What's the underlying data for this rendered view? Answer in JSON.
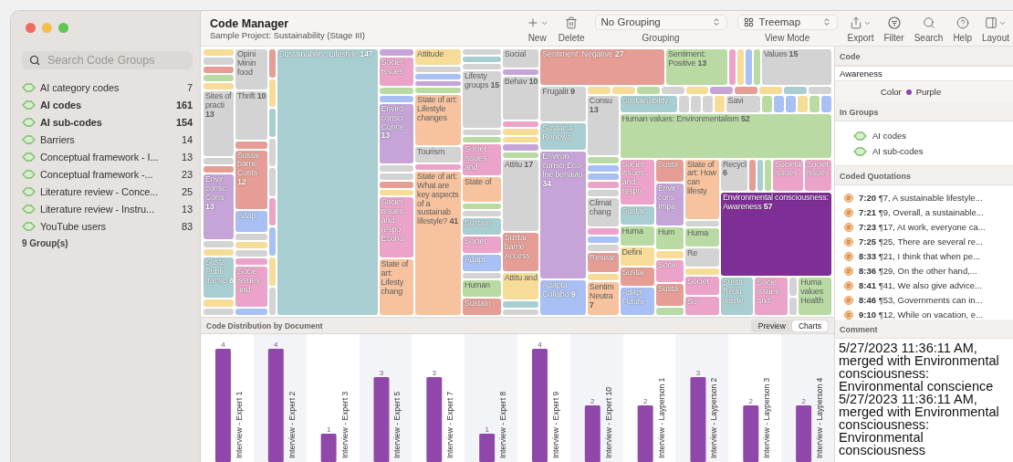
{
  "window": {
    "title": "Code Manager",
    "subtitle": "Sample Project: Sustainability (Stage III)"
  },
  "sidebar": {
    "search": {
      "placeholder": "Search Code Groups"
    },
    "items": [
      {
        "label": "AI category codes",
        "count": "7",
        "selected": false
      },
      {
        "label": "AI codes",
        "count": "161",
        "selected": true
      },
      {
        "label": "AI sub-codes",
        "count": "154",
        "selected": true
      },
      {
        "label": "Barriers",
        "count": "14",
        "selected": false
      },
      {
        "label": "Conceptual framework - I...",
        "count": "13",
        "selected": false
      },
      {
        "label": "Conceptual framework -...",
        "count": "23",
        "selected": false
      },
      {
        "label": "Literature review - Conce...",
        "count": "25",
        "selected": false
      },
      {
        "label": "Literature review - Instru...",
        "count": "13",
        "selected": false
      },
      {
        "label": "YouTube users",
        "count": "83",
        "selected": false
      }
    ],
    "footer": "9 Group(s)"
  },
  "toolbar": [
    {
      "kind": "new",
      "label": "New"
    },
    {
      "kind": "delete",
      "label": "Delete"
    },
    {
      "kind": "grouping",
      "value": "No Grouping",
      "label": "Grouping"
    },
    {
      "kind": "viewmode",
      "value": "Treemap",
      "label": "View Mode"
    },
    {
      "kind": "export",
      "label": "Export"
    },
    {
      "kind": "filter",
      "label": "Filter"
    },
    {
      "kind": "search",
      "label": "Search"
    },
    {
      "kind": "help",
      "label": "Help"
    },
    {
      "kind": "layout",
      "label": "Layout"
    }
  ],
  "treemap": {
    "kind": "row",
    "children": [
      {
        "kind": "col",
        "children": [
          {
            "kind": "tile",
            "color": "#f6dc97"
          },
          {
            "kind": "tile",
            "color": "#d3d3d3"
          },
          {
            "kind": "tile",
            "color": "#e59d95"
          },
          {
            "kind": "tile",
            "color": "#b9dba3"
          },
          {
            "kind": "tile",
            "color": "#f6dc97"
          },
          {
            "kind": "tile",
            "label": "Sites of practi",
            "count": "13",
            "color": "#d3d3d3"
          },
          {
            "kind": "tile",
            "color": "#d3d3d3"
          },
          {
            "kind": "tile",
            "color": "#e59d95"
          },
          {
            "kind": "tile",
            "label": "Envir consc Cons",
            "count": "13",
            "color": "#c6a4d8"
          },
          {
            "kind": "tile",
            "color": "#d3d3d3"
          },
          {
            "kind": "tile",
            "color": "#f6dc97"
          },
          {
            "kind": "tile",
            "label": "Susta Publi transp",
            "count": "8",
            "color": "#a8ced2"
          },
          {
            "kind": "tile",
            "color": "#f6dc97"
          },
          {
            "kind": "tile",
            "color": "#d3d3d3"
          }
        ]
      },
      {
        "kind": "col",
        "children": [
          {
            "kind": "tile",
            "label": "Opini Minin food",
            "color": "#d3d3d3"
          },
          {
            "kind": "tile",
            "label": "Thrift",
            "count": "10",
            "color": "#d3d3d3"
          },
          {
            "kind": "tile",
            "color": "#e59d95"
          },
          {
            "kind": "tile",
            "label": "Sustai barrie Costs",
            "count": "12",
            "color": "#e59d95"
          },
          {
            "kind": "tile",
            "label": "Adap",
            "color": "#a8c0f3"
          },
          {
            "kind": "tile",
            "color": "#d3d3d3"
          },
          {
            "kind": "tile",
            "color": "#f6dc97"
          },
          {
            "kind": "tile",
            "color": "#d3d3d3"
          },
          {
            "kind": "tile",
            "color": "#eba3c9"
          },
          {
            "kind": "tile",
            "label": "Socie issues and",
            "color": "#eba3c9"
          },
          {
            "kind": "tile",
            "color": "#a8c0f3"
          }
        ]
      },
      {
        "kind": "col",
        "children": [
          {
            "kind": "tile",
            "color": "#e59d95"
          },
          {
            "kind": "tile",
            "color": "#f6dc97"
          },
          {
            "kind": "tile",
            "color": "#a8ced2"
          },
          {
            "kind": "tile",
            "color": "#d3d3d3"
          },
          {
            "kind": "tile",
            "color": "#d3d3d3"
          },
          {
            "kind": "tile",
            "color": "#eba3c9"
          },
          {
            "kind": "tile",
            "color": "#a8c0f3"
          },
          {
            "kind": "tile",
            "color": "#f6dc97"
          },
          {
            "kind": "tile",
            "color": "#d3d3d3"
          }
        ]
      },
      {
        "kind": "tile",
        "label": "Sustainability: Lifestyle",
        "count": "147",
        "color": "#a8ced2"
      },
      {
        "kind": "col",
        "children": [
          {
            "kind": "tile",
            "color": "#c6a4d8"
          },
          {
            "kind": "tile",
            "label": "Societ issues",
            "color": "#eba3c9"
          },
          {
            "kind": "tile",
            "color": "#b9dba3"
          },
          {
            "kind": "tile",
            "color": "#a8c0f3"
          },
          {
            "kind": "tile",
            "label": "Enviro consci Conce",
            "count": "13",
            "color": "#c6a4d8"
          },
          {
            "kind": "tile",
            "color": "#d3d3d3"
          },
          {
            "kind": "tile",
            "color": "#d3d3d3"
          },
          {
            "kind": "tile",
            "color": "#e59d95"
          },
          {
            "kind": "tile",
            "color": "#f6dc97"
          },
          {
            "kind": "tile",
            "label": "Societ issues and respo Econo",
            "color": "#eba3c9"
          },
          {
            "kind": "tile",
            "label": "State of art: Lifesty chang",
            "color": "#f7c39f"
          }
        ]
      },
      {
        "kind": "col",
        "children": [
          {
            "kind": "tile",
            "label": "Attitude",
            "color": "#f6dc97"
          },
          {
            "kind": "tile",
            "color": "#d3d3d3"
          },
          {
            "kind": "tile",
            "color": "#a8c0f3"
          },
          {
            "kind": "tile",
            "color": "#c6a4d8"
          },
          {
            "kind": "tile",
            "color": "#b9dba3"
          },
          {
            "kind": "tile",
            "label": "State of art: Lifestyle changes",
            "color": "#f7c39f"
          },
          {
            "kind": "tile",
            "label": "Tourism",
            "color": "#d3d3d3"
          },
          {
            "kind": "tile",
            "color": "#eba3c9"
          },
          {
            "kind": "tile",
            "label": "State of art: What are key aspects of a sustainab lifestyle?",
            "count": "41",
            "color": "#f7c39f"
          }
        ]
      },
      {
        "kind": "col",
        "children": [
          {
            "kind": "tile",
            "color": "#d3d3d3"
          },
          {
            "kind": "tile",
            "color": "#a8ced2"
          },
          {
            "kind": "tile",
            "color": "#d3d3d3"
          },
          {
            "kind": "tile",
            "label": "Lifesty groups",
            "count": "15",
            "color": "#d3d3d3"
          },
          {
            "kind": "tile",
            "color": "#d3d3d3"
          },
          {
            "kind": "tile",
            "color": "#b9dba3"
          },
          {
            "kind": "tile",
            "label": "Societ issues and",
            "color": "#eba3c9"
          },
          {
            "kind": "tile",
            "label": "State of",
            "color": "#f7c39f"
          },
          {
            "kind": "tile",
            "color": "#b9dba3"
          },
          {
            "kind": "tile",
            "color": "#d3d3d3"
          },
          {
            "kind": "tile",
            "label": "Sustain",
            "color": "#a8ced2"
          },
          {
            "kind": "tile",
            "label": "Societ",
            "color": "#eba3c9"
          },
          {
            "kind": "tile",
            "label": "Adapt",
            "color": "#a8c0f3"
          },
          {
            "kind": "tile",
            "color": "#d3d3d3"
          },
          {
            "kind": "tile",
            "label": "Human",
            "color": "#b9dba3"
          },
          {
            "kind": "tile",
            "label": "Sustain",
            "color": "#e59d95"
          }
        ]
      },
      {
        "kind": "col",
        "children": [
          {
            "kind": "tile",
            "label": "Social",
            "color": "#d3d3d3"
          },
          {
            "kind": "tile",
            "color": "#c6a4d8"
          },
          {
            "kind": "tile",
            "label": "Behav",
            "count": "10",
            "color": "#d3d3d3"
          },
          {
            "kind": "tile",
            "color": "#eba3c9"
          },
          {
            "kind": "tile",
            "color": "#f6dc97"
          },
          {
            "kind": "tile",
            "color": "#f6dc97"
          },
          {
            "kind": "tile",
            "color": "#c6a4d8"
          },
          {
            "kind": "tile",
            "color": "#b9dba3"
          },
          {
            "kind": "tile",
            "label": "Attitu",
            "count": "17",
            "color": "#d3d3d3"
          },
          {
            "kind": "tile",
            "label": "Sustai barrie Access",
            "color": "#e59d95"
          },
          {
            "kind": "tile",
            "label": "Attitu and",
            "color": "#f6dc97"
          },
          {
            "kind": "tile",
            "color": "#a8ced2"
          },
          {
            "kind": "tile",
            "color": "#d3d3d3"
          }
        ]
      },
      {
        "kind": "col",
        "children": [
          {
            "kind": "row",
            "children": [
              {
                "kind": "tile",
                "label": "Sentiment: Negative",
                "count": "27",
                "color": "#e59d95"
              },
              {
                "kind": "tile",
                "label": "Sentiment: Positive",
                "count": "13",
                "color": "#b9dba3"
              },
              {
                "kind": "tile",
                "color": "#eba3c9"
              },
              {
                "kind": "tile",
                "color": "#f6dc97"
              },
              {
                "kind": "tile",
                "color": "#a8c0f3"
              },
              {
                "kind": "tile",
                "color": "#b9dba3"
              },
              {
                "kind": "tile",
                "label": "Values",
                "count": "15",
                "color": "#d3d3d3"
              }
            ]
          },
          {
            "kind": "row",
            "children": [
              {
                "kind": "col",
                "children": [
                  {
                    "kind": "tile",
                    "label": "Frugalit",
                    "count": "9",
                    "color": "#d3d3d3"
                  },
                  {
                    "kind": "tile",
                    "label": "Sustaina Renewa",
                    "color": "#a8ced2"
                  },
                  {
                    "kind": "tile",
                    "label": "Environ consci Eco-frie behavio",
                    "count": "34",
                    "color": "#c6a4d8"
                  },
                  {
                    "kind": "tile",
                    "label": "Adapta Collabo",
                    "count": "9",
                    "color": "#a8c0f3"
                  }
                ]
              },
              {
                "kind": "col",
                "children": [
                  {
                    "kind": "row",
                    "children": [
                      {
                        "kind": "tile",
                        "color": "#f6dc97"
                      },
                      {
                        "kind": "tile",
                        "color": "#f6dc97"
                      },
                      {
                        "kind": "tile",
                        "color": "#b9dba3"
                      },
                      {
                        "kind": "tile",
                        "color": "#d3d3d3"
                      },
                      {
                        "kind": "tile",
                        "color": "#f6dc97"
                      },
                      {
                        "kind": "tile",
                        "color": "#c6a4d8"
                      },
                      {
                        "kind": "tile",
                        "color": "#e59d95"
                      },
                      {
                        "kind": "tile",
                        "color": "#f6dc97"
                      },
                      {
                        "kind": "tile",
                        "color": "#a8ced2"
                      },
                      {
                        "kind": "tile",
                        "color": "#d3d3d3"
                      }
                    ]
                  },
                  {
                    "kind": "row",
                    "children": [
                      {
                        "kind": "col",
                        "children": [
                          {
                            "kind": "tile",
                            "label": "Consu",
                            "count": "13",
                            "color": "#d3d3d3"
                          },
                          {
                            "kind": "tile",
                            "color": "#b9dba3"
                          },
                          {
                            "kind": "tile",
                            "color": "#a8c0f3"
                          },
                          {
                            "kind": "tile",
                            "color": "#a8c0f3"
                          },
                          {
                            "kind": "tile",
                            "color": "#eba3c9"
                          },
                          {
                            "kind": "tile",
                            "color": "#d3d3d3"
                          },
                          {
                            "kind": "tile",
                            "label": "Climat chang",
                            "color": "#d3d3d3"
                          },
                          {
                            "kind": "tile",
                            "color": "#eba3c9"
                          },
                          {
                            "kind": "tile",
                            "color": "#a8c0f3"
                          },
                          {
                            "kind": "tile",
                            "color": "#d3d3d3"
                          },
                          {
                            "kind": "tile",
                            "label": "Resear",
                            "color": "#e59d95"
                          },
                          {
                            "kind": "tile",
                            "color": "#f6dc97"
                          },
                          {
                            "kind": "tile",
                            "label": "Sentim Neutra",
                            "count": "7",
                            "color": "#f7c39f"
                          }
                        ]
                      },
                      {
                        "kind": "col",
                        "children": [
                          {
                            "kind": "row",
                            "children": [
                              {
                                "kind": "tile",
                                "label": "Sustainability:",
                                "color": "#a8ced2"
                              },
                              {
                                "kind": "tile",
                                "color": "#d3d3d3"
                              },
                              {
                                "kind": "tile",
                                "color": "#d3d3d3"
                              },
                              {
                                "kind": "tile",
                                "color": "#d3d3d3"
                              },
                              {
                                "kind": "tile",
                                "color": "#f6dc97"
                              },
                              {
                                "kind": "tile",
                                "label": "Savi",
                                "color": "#d3d3d3"
                              },
                              {
                                "kind": "tile",
                                "color": "#b9dba3"
                              },
                              {
                                "kind": "tile",
                                "color": "#a8c0f3"
                              },
                              {
                                "kind": "tile",
                                "color": "#a8c0f3"
                              },
                              {
                                "kind": "tile",
                                "color": "#f6dc97"
                              },
                              {
                                "kind": "tile",
                                "color": "#b9dba3"
                              },
                              {
                                "kind": "tile",
                                "color": "#a8c0f3"
                              }
                            ]
                          },
                          {
                            "kind": "tile",
                            "label": "Human values: Environmentalism",
                            "count": "52",
                            "color": "#b9dba3"
                          },
                          {
                            "kind": "row",
                            "children": [
                              {
                                "kind": "col",
                                "children": [
                                  {
                                    "kind": "tile",
                                    "label": "Societ issues and respo",
                                    "color": "#eba3c9"
                                  },
                                  {
                                    "kind": "tile",
                                    "label": "Sustai",
                                    "color": "#a8ced2"
                                  },
                                  {
                                    "kind": "tile",
                                    "label": "Huma",
                                    "color": "#b9dba3"
                                  },
                                  {
                                    "kind": "tile",
                                    "label": "Defini",
                                    "color": "#f6dc97"
                                  },
                                  {
                                    "kind": "tile",
                                    "label": "Sustai",
                                    "color": "#e59d95"
                                  },
                                  {
                                    "kind": "tile",
                                    "label": "Adapt Future",
                                    "color": "#a8c0f3"
                                  }
                                ]
                              },
                              {
                                "kind": "col",
                                "children": [
                                  {
                                    "kind": "tile",
                                    "label": "Susta",
                                    "color": "#e59d95"
                                  },
                                  {
                                    "kind": "tile",
                                    "label": "Envir cons Impa",
                                    "color": "#c6a4d8"
                                  },
                                  {
                                    "kind": "tile",
                                    "label": "Hum",
                                    "color": "#b9dba3"
                                  },
                                  {
                                    "kind": "tile",
                                    "color": "#f6dc97"
                                  },
                                  {
                                    "kind": "tile",
                                    "label": "Socie",
                                    "color": "#eba3c9"
                                  },
                                  {
                                    "kind": "tile",
                                    "label": "Susta",
                                    "color": "#e59d95"
                                  },
                                  {
                                    "kind": "tile",
                                    "color": "#b9dba3"
                                  }
                                ]
                              },
                              {
                                "kind": "col",
                                "children": [
                                  {
                                    "kind": "tile",
                                    "label": "State of art: How can lifesty",
                                    "color": "#f7c39f"
                                  },
                                  {
                                    "kind": "tile",
                                    "color": "#d3d3d3"
                                  },
                                  {
                                    "kind": "tile",
                                    "label": "Huma",
                                    "color": "#b9dba3"
                                  },
                                  {
                                    "kind": "tile",
                                    "label": "Re",
                                    "color": "#d3d3d3"
                                  },
                                  {
                                    "kind": "tile",
                                    "color": "#f6dc97"
                                  },
                                  {
                                    "kind": "tile",
                                    "label": "Societ",
                                    "color": "#eba3c9"
                                  },
                                  {
                                    "kind": "tile",
                                    "label": "So",
                                    "color": "#eba3c9"
                                  }
                                ]
                              },
                              {
                                "kind": "col",
                                "children": [
                                  {
                                    "kind": "row",
                                    "children": [
                                      {
                                        "kind": "tile",
                                        "label": "Recycl",
                                        "count": "6",
                                        "color": "#d3d3d3"
                                      },
                                      {
                                        "kind": "tile",
                                        "color": "#e59d95"
                                      },
                                      {
                                        "kind": "tile",
                                        "color": "#a8ced2"
                                      },
                                      {
                                        "kind": "tile",
                                        "color": "#b9dba3"
                                      },
                                      {
                                        "kind": "tile",
                                        "label": "Societal issues",
                                        "color": "#eba3c9"
                                      },
                                      {
                                        "kind": "tile",
                                        "label": "Societ issues",
                                        "color": "#eba3c9"
                                      }
                                    ]
                                  },
                                  {
                                    "kind": "tile",
                                    "label": "Environmental consciousness: Awareness",
                                    "count": "57",
                                    "color": "#7e2f96"
                                  },
                                  {
                                    "kind": "row",
                                    "children": [
                                      {
                                        "kind": "tile",
                                        "label": "Susta Redu waste",
                                        "color": "#a8ced2"
                                      },
                                      {
                                        "kind": "tile",
                                        "label": "Socie issues and",
                                        "color": "#eba3c9"
                                      },
                                      {
                                        "kind": "col",
                                        "children": [
                                          {
                                            "kind": "tile",
                                            "color": "#d3d3d3"
                                          },
                                          {
                                            "kind": "tile",
                                            "color": "#d3d3d3"
                                          }
                                        ]
                                      },
                                      {
                                        "kind": "tile",
                                        "label": "Huma values Health",
                                        "color": "#b9dba3"
                                      }
                                    ]
                                  }
                                ]
                              }
                            ]
                          }
                        ]
                      }
                    ]
                  }
                ]
              }
            ]
          }
        ]
      }
    ]
  },
  "distribution": {
    "title": "Code Distribution by Document",
    "tabs": [
      {
        "label": "Preview",
        "selected": false
      },
      {
        "label": "Charts",
        "selected": true
      }
    ],
    "chart_data": {
      "type": "bar",
      "categories": [
        "Interview - Expert 1",
        "Interview - Expert 2",
        "Interview - Expert 3",
        "Interview - Expert 5",
        "Interview - Expert 7",
        "Interview - Expert 8",
        "Interview - Expert 9",
        "Interview - Expert 10",
        "Interview - Layperson 1",
        "Interview - Layperson 2",
        "Interview - Layperson 3",
        "Interview - Layperson 4"
      ],
      "series": [
        {
          "color": "#8f48aa",
          "values": [
            4,
            4,
            1,
            3,
            3,
            1,
            4,
            2,
            2,
            3,
            2,
            2
          ]
        }
      ],
      "data_labels": true
    }
  },
  "inspector": {
    "code_header": "Code",
    "code_value": "Awareness",
    "color_label": "Color",
    "color_name": "Purple",
    "color": "#8e44ad",
    "groups_header": "In Groups",
    "groups": [
      "AI codes",
      "AI sub-codes"
    ],
    "quotations_header": "Coded Quotations",
    "quotations": [
      "**7:20** ¶7, A sustainable lifestyle...",
      "**7:21** ¶9, Overall, a sustainable...",
      "**7:23** ¶17, At work, everyone ca...",
      "**7:25** ¶25, There are several re...",
      "**8:33** ¶21, I think that when pe...",
      "**8:36** ¶29, On the other hand,...",
      "**8:41** ¶41, We also give advice...",
      "**8:46** ¶53, Governments can in...",
      "**9:10** ¶12, While on vacation, e..."
    ],
    "comment_header": "Comment",
    "comment": [
      "5/27/2023 11:36:11 AM, merged with Environmental consciousness: Environmental conscience",
      "5/27/2023 11:36:11 AM, merged with Environmental consciousness: Environmental consciousness"
    ]
  }
}
